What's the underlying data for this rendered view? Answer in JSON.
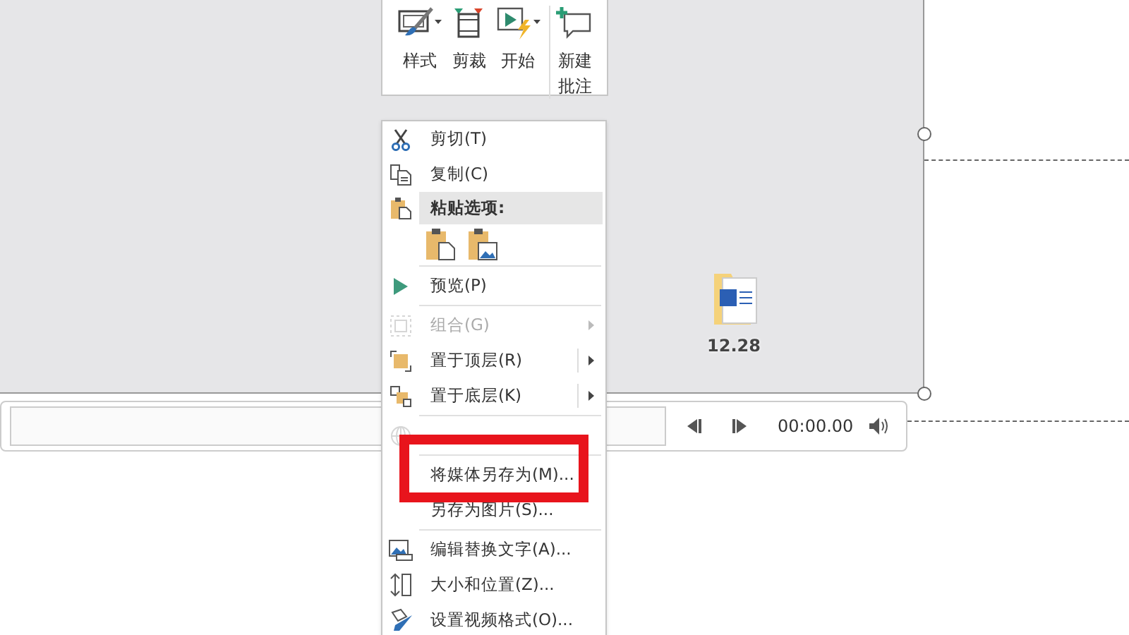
{
  "toolbar": {
    "buttons": [
      {
        "label": "样式",
        "dropdown": true
      },
      {
        "label": "剪裁",
        "dropdown": false
      },
      {
        "label": "开始",
        "dropdown": true
      },
      {
        "label": "新建批注",
        "dropdown": false
      }
    ]
  },
  "context_menu": {
    "items": [
      {
        "kind": "item",
        "label": "剪切(T)",
        "disabled": false,
        "submenu": false
      },
      {
        "kind": "item",
        "label": "复制(C)",
        "disabled": false,
        "submenu": false
      },
      {
        "kind": "header",
        "label": "粘贴选项:"
      },
      {
        "kind": "paste"
      },
      {
        "kind": "separator"
      },
      {
        "kind": "item",
        "label": "预览(P)",
        "disabled": false,
        "submenu": false
      },
      {
        "kind": "separator"
      },
      {
        "kind": "item",
        "label": "组合(G)",
        "disabled": true,
        "submenu": true
      },
      {
        "kind": "item",
        "label": "置于顶层(R)",
        "disabled": false,
        "submenu": true
      },
      {
        "kind": "item",
        "label": "置于底层(K)",
        "disabled": false,
        "submenu": true
      },
      {
        "kind": "separator"
      },
      {
        "kind": "item",
        "disabled": true,
        "submenu": false
      },
      {
        "kind": "separator"
      },
      {
        "kind": "item",
        "label": "将媒体另存为(M)...",
        "disabled": false,
        "submenu": false
      },
      {
        "kind": "item",
        "label": "另存为图片(S)...",
        "disabled": false,
        "submenu": false
      },
      {
        "kind": "separator"
      },
      {
        "kind": "item",
        "label": "编辑替换文字(A)...",
        "disabled": false,
        "submenu": false
      },
      {
        "kind": "item",
        "label": "大小和位置(Z)...",
        "disabled": false,
        "submenu": false
      },
      {
        "kind": "item",
        "label": "设置视频格式(O)...",
        "disabled": false,
        "submenu": false
      }
    ]
  },
  "desktop_file": {
    "label": "12.28"
  },
  "player": {
    "time": "00:00.00"
  }
}
